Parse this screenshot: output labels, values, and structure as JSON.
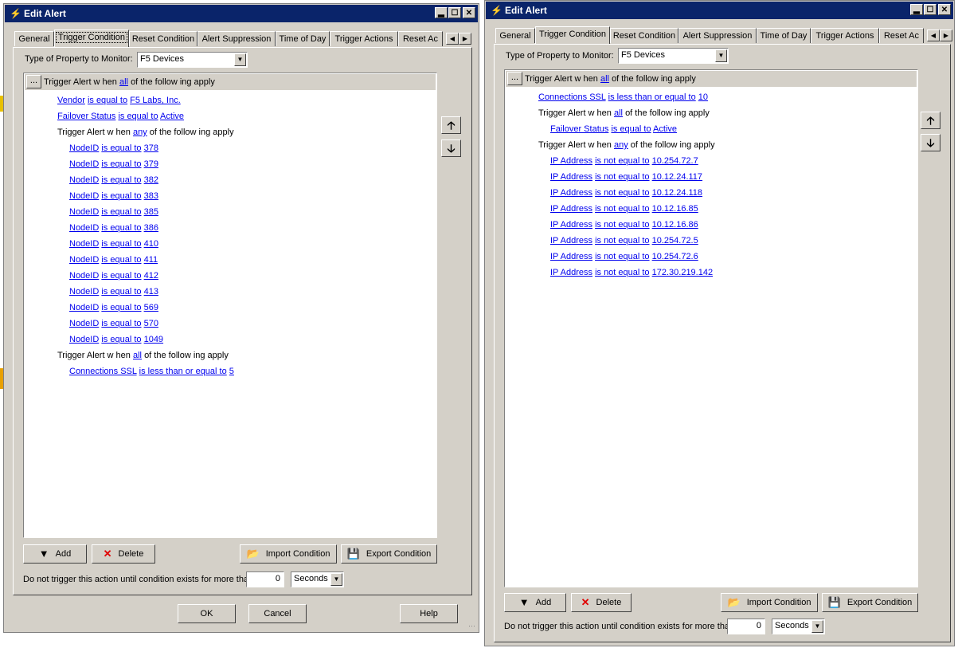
{
  "windows": [
    {
      "title": "Edit Alert",
      "tabs": [
        "General",
        "Trigger Condition",
        "Reset Condition",
        "Alert Suppression",
        "Time of Day",
        "Trigger Actions",
        "Reset Ac"
      ],
      "active_tab": 1,
      "property_label": "Type of Property to Monitor:",
      "property_value": "F5 Devices",
      "header": {
        "dots": "...",
        "pre": "Trigger Alert w hen",
        "mode": "all",
        "post": "of the follow ing apply"
      },
      "rows": [
        {
          "indent": 1,
          "type": "cond",
          "field": "Vendor",
          "op": "is equal to",
          "value": "F5 Labs, Inc."
        },
        {
          "indent": 1,
          "type": "cond",
          "field": "Failover Status",
          "op": "is equal to",
          "value": "Active"
        },
        {
          "indent": 1,
          "type": "group",
          "pre": "Trigger Alert w hen",
          "mode": "any",
          "post": "of the follow ing apply"
        },
        {
          "indent": 2,
          "type": "cond",
          "field": "NodeID",
          "op": "is equal to",
          "value": "378"
        },
        {
          "indent": 2,
          "type": "cond",
          "field": "NodeID",
          "op": "is equal to",
          "value": "379"
        },
        {
          "indent": 2,
          "type": "cond",
          "field": "NodeID",
          "op": "is equal to",
          "value": "382"
        },
        {
          "indent": 2,
          "type": "cond",
          "field": "NodeID",
          "op": "is equal to",
          "value": "383"
        },
        {
          "indent": 2,
          "type": "cond",
          "field": "NodeID",
          "op": "is equal to",
          "value": "385"
        },
        {
          "indent": 2,
          "type": "cond",
          "field": "NodeID",
          "op": "is equal to",
          "value": "386"
        },
        {
          "indent": 2,
          "type": "cond",
          "field": "NodeID",
          "op": "is equal to",
          "value": "410"
        },
        {
          "indent": 2,
          "type": "cond",
          "field": "NodeID",
          "op": "is equal to",
          "value": "411"
        },
        {
          "indent": 2,
          "type": "cond",
          "field": "NodeID",
          "op": "is equal to",
          "value": "412"
        },
        {
          "indent": 2,
          "type": "cond",
          "field": "NodeID",
          "op": "is equal to",
          "value": "413"
        },
        {
          "indent": 2,
          "type": "cond",
          "field": "NodeID",
          "op": "is equal to",
          "value": "569"
        },
        {
          "indent": 2,
          "type": "cond",
          "field": "NodeID",
          "op": "is equal to",
          "value": "570"
        },
        {
          "indent": 2,
          "type": "cond",
          "field": "NodeID",
          "op": "is equal to",
          "value": "1049"
        },
        {
          "indent": 1,
          "type": "group",
          "pre": "Trigger Alert w hen",
          "mode": "all",
          "post": "of the follow ing apply"
        },
        {
          "indent": 2,
          "type": "cond",
          "field": "Connections SSL",
          "op": "is less than or equal to",
          "value": "5"
        }
      ],
      "buttons": {
        "add": "Add",
        "delete": "Delete",
        "import": "Import Condition",
        "export": "Export Condition"
      },
      "delay_label": "Do not trigger this action until condition exists for more than",
      "delay_value": "0",
      "delay_unit": "Seconds",
      "footer": {
        "ok": "OK",
        "cancel": "Cancel",
        "help": "Help"
      }
    },
    {
      "title": "Edit Alert",
      "tabs": [
        "General",
        "Trigger Condition",
        "Reset Condition",
        "Alert Suppression",
        "Time of Day",
        "Trigger Actions",
        "Reset Ac"
      ],
      "active_tab": 1,
      "property_label": "Type of Property to Monitor:",
      "property_value": "F5 Devices",
      "header": {
        "dots": "...",
        "pre": "Trigger Alert w hen",
        "mode": "all",
        "post": "of the follow ing apply"
      },
      "rows": [
        {
          "indent": 1,
          "type": "cond",
          "field": "Connections SSL",
          "op": "is less than or equal to",
          "value": "10"
        },
        {
          "indent": 1,
          "type": "group",
          "pre": "Trigger Alert w hen",
          "mode": "all",
          "post": "of the follow ing apply"
        },
        {
          "indent": 2,
          "type": "cond",
          "field": "Failover Status",
          "op": "is equal to",
          "value": "Active"
        },
        {
          "indent": 1,
          "type": "group",
          "pre": "Trigger Alert w hen",
          "mode": "any",
          "post": "of the follow ing apply"
        },
        {
          "indent": 2,
          "type": "cond",
          "field": "IP Address",
          "op": "is not equal to",
          "value": "10.254.72.7"
        },
        {
          "indent": 2,
          "type": "cond",
          "field": "IP Address",
          "op": "is not equal to",
          "value": "10.12.24.117"
        },
        {
          "indent": 2,
          "type": "cond",
          "field": "IP Address",
          "op": "is not equal to",
          "value": "10.12.24.118"
        },
        {
          "indent": 2,
          "type": "cond",
          "field": "IP Address",
          "op": "is not equal to",
          "value": "10.12.16.85"
        },
        {
          "indent": 2,
          "type": "cond",
          "field": "IP Address",
          "op": "is not equal to",
          "value": "10.12.16.86"
        },
        {
          "indent": 2,
          "type": "cond",
          "field": "IP Address",
          "op": "is not equal to",
          "value": "10.254.72.5"
        },
        {
          "indent": 2,
          "type": "cond",
          "field": "IP Address",
          "op": "is not equal to",
          "value": "10.254.72.6"
        },
        {
          "indent": 2,
          "type": "cond",
          "field": "IP Address",
          "op": "is not equal to",
          "value": "172.30.219.142"
        }
      ],
      "buttons": {
        "add": "Add",
        "delete": "Delete",
        "import": "Import Condition",
        "export": "Export Condition"
      },
      "delay_label": "Do not trigger this action until condition exists for more than",
      "delay_value": "0",
      "delay_unit": "Seconds"
    }
  ],
  "icons": {
    "app": "lightning-icon",
    "minimize": "minimize-icon",
    "maximize": "maximize-icon",
    "close": "close-icon",
    "move_up": "arrow-up-icon",
    "move_down": "arrow-down-icon",
    "add": "filter-add-icon",
    "delete": "red-x-icon",
    "import": "folder-open-icon",
    "export": "floppy-disk-icon"
  },
  "colors": {
    "title_bar": "#0a246a",
    "dialog_bg": "#d4d0c8",
    "link": "#0000ee",
    "delete_x": "#e00000"
  }
}
